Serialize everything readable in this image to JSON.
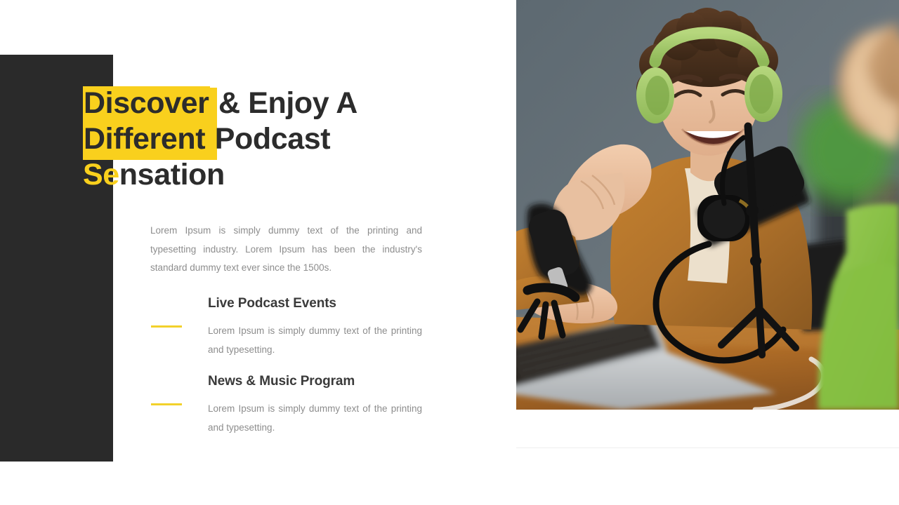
{
  "slide": {
    "headline": {
      "line1_highlight": "Discover",
      "line1_rest": " & Enjoy A",
      "line2_highlight": "Different",
      "line2_rest": " Podcast",
      "line3_accent": "Se",
      "line3_rest": "nsation"
    },
    "lead_paragraph": "Lorem Ipsum is simply dummy text of the printing and typesetting industry. Lorem Ipsum has been the industry's standard dummy text ever since the 1500s.",
    "features": [
      {
        "title": "Live Podcast Events",
        "text": "Lorem Ipsum is simply dummy text of the printing and typesetting."
      },
      {
        "title": "News & Music Program",
        "text": "Lorem Ipsum is simply dummy text of the printing and typesetting."
      }
    ],
    "photo": {
      "alt": "Smiling young man with curly hair wearing green headphones speaking into a studio microphone at a wooden desk, second person in green jacket in foreground",
      "backdrop_color": "#65717a",
      "headphone_color": "#a6cf6b",
      "jacket_color": "#b5762f",
      "desk_color": "#b5712c",
      "green_jacket_color": "#8bc34a"
    },
    "colors": {
      "accent_yellow": "#f9d01d",
      "dash_yellow": "#f2d12b",
      "dark_panel": "#2a2a2a",
      "heading_text": "#2c2c2c",
      "feature_title_text": "#3a3a3a",
      "body_text": "#8d8d8d",
      "divider": "#efefef",
      "background": "#ffffff"
    }
  }
}
